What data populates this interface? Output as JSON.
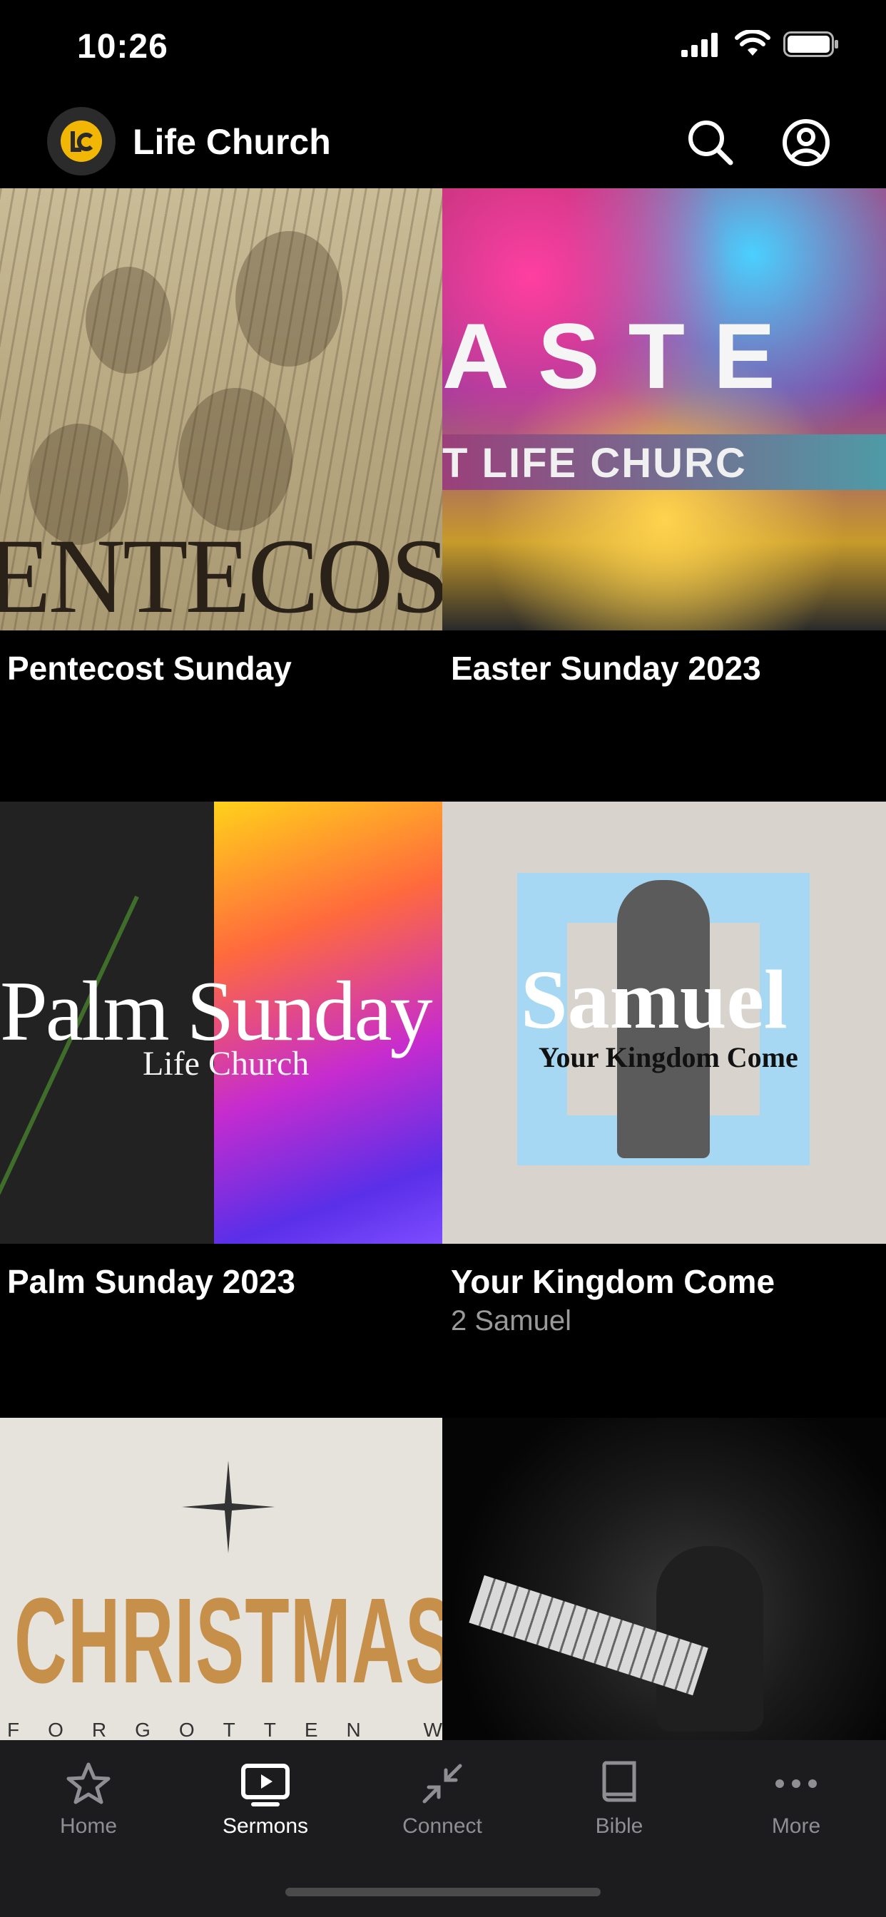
{
  "status_bar": {
    "time": "10:26"
  },
  "header": {
    "app_title": "Life Church",
    "logo_icon": "life-church-logo",
    "search_icon": "search-icon",
    "account_icon": "person-circle-icon"
  },
  "sermons": [
    {
      "title": "Pentecost Sunday",
      "subtitle": "",
      "art_text": "ENTECOS"
    },
    {
      "title": "Easter Sunday 2023",
      "subtitle": "",
      "art_text": "ASTE",
      "art_band_text": "T LIFE CHURC"
    },
    {
      "title": "Palm Sunday 2023",
      "subtitle": "",
      "art_text": "Palm Sunday",
      "art_subtext": "Life Church"
    },
    {
      "title": "Your Kingdom Come",
      "subtitle": "2 Samuel",
      "art_text": "Samuel",
      "art_subtext": "Your Kingdom Come"
    },
    {
      "title": "",
      "subtitle": "",
      "art_text": "CHRISTMAS",
      "art_subtext": "FORGOTTEN WITNE"
    },
    {
      "title": "",
      "subtitle": ""
    }
  ],
  "tab_bar": {
    "items": [
      {
        "label": "Home",
        "icon": "star-icon",
        "active": false
      },
      {
        "label": "Sermons",
        "icon": "play-screen-icon",
        "active": true
      },
      {
        "label": "Connect",
        "icon": "arrows-inward-icon",
        "active": false
      },
      {
        "label": "Bible",
        "icon": "book-icon",
        "active": false
      },
      {
        "label": "More",
        "icon": "ellipsis-icon",
        "active": false
      }
    ]
  },
  "colors": {
    "background": "#000000",
    "tab_bar": "#1c1c1e",
    "inactive": "#8e8e93",
    "logo_accent": "#f2b705"
  }
}
